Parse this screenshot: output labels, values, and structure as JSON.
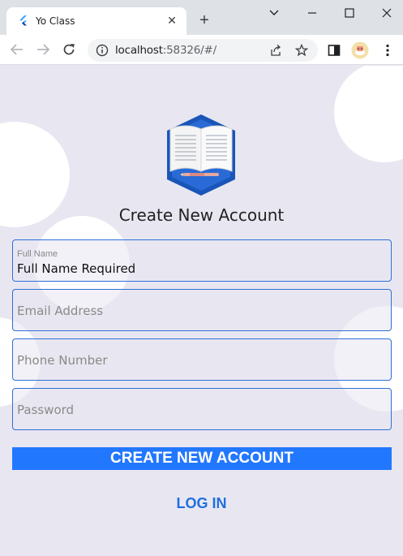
{
  "browser": {
    "tab_title": "Yo Class",
    "url_host": "localhost",
    "url_rest": ":58326/#/",
    "new_tab_label": "+",
    "close_label": "✕"
  },
  "app": {
    "heading": "Create New Account",
    "fields": {
      "full_name": {
        "label": "Full Name",
        "value": "Full Name Required"
      },
      "email": {
        "placeholder": "Email Address"
      },
      "phone": {
        "placeholder": "Phone Number"
      },
      "password": {
        "placeholder": "Password"
      }
    },
    "create_button": "CREATE NEW ACCOUNT",
    "login_link": "LOG IN"
  },
  "colors": {
    "accent": "#2277ff",
    "border": "#2f6fd6",
    "background": "#e8e7f1",
    "link": "#1f6fe0"
  }
}
